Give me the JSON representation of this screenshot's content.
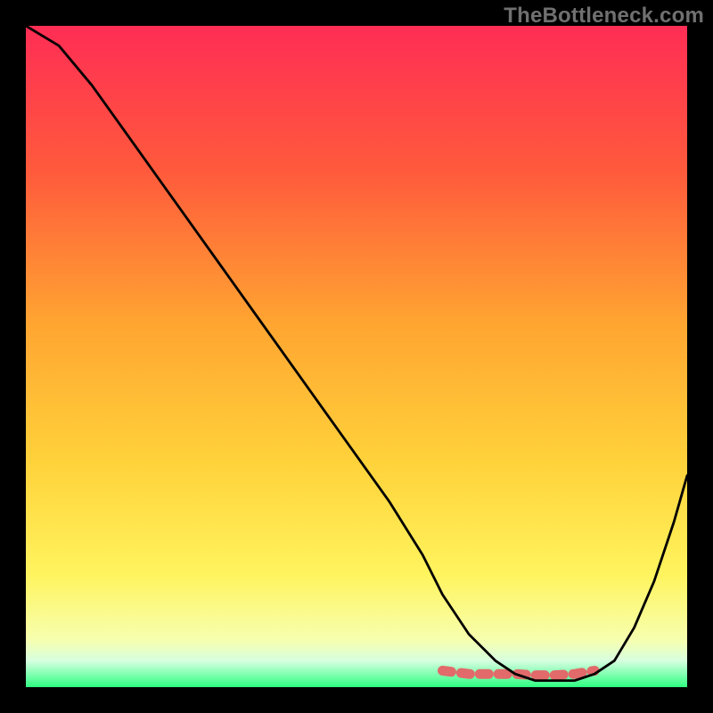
{
  "watermark": "TheBottleneck.com",
  "gradient_stops": [
    {
      "offset": "0%",
      "color": "#ff2d55"
    },
    {
      "offset": "22%",
      "color": "#ff5a3c"
    },
    {
      "offset": "45%",
      "color": "#ffa531"
    },
    {
      "offset": "66%",
      "color": "#ffd23a"
    },
    {
      "offset": "83%",
      "color": "#fff45e"
    },
    {
      "offset": "93%",
      "color": "#f6ffb0"
    },
    {
      "offset": "96%",
      "color": "#d7ffe0"
    },
    {
      "offset": "100%",
      "color": "#2eff82"
    }
  ],
  "chart_data": {
    "type": "line",
    "title": "",
    "xlabel": "",
    "ylabel": "",
    "xlim": [
      0,
      100
    ],
    "ylim": [
      0,
      100
    ],
    "series": [
      {
        "name": "bottleneck-curve",
        "x": [
          0,
          5,
          10,
          15,
          20,
          25,
          30,
          35,
          40,
          45,
          50,
          55,
          60,
          63,
          67,
          71,
          74,
          77,
          80,
          83,
          86,
          89,
          92,
          95,
          98,
          100
        ],
        "y": [
          100,
          97,
          91,
          84,
          77,
          70,
          63,
          56,
          49,
          42,
          35,
          28,
          20,
          14,
          8,
          4,
          2,
          1,
          1,
          1,
          2,
          4,
          9,
          16,
          25,
          32
        ]
      },
      {
        "name": "optimal-range",
        "x": [
          63,
          67,
          71,
          74,
          77,
          80,
          83,
          86
        ],
        "y": [
          2.5,
          2,
          2,
          2,
          1.8,
          1.8,
          2,
          2.5
        ]
      }
    ]
  }
}
